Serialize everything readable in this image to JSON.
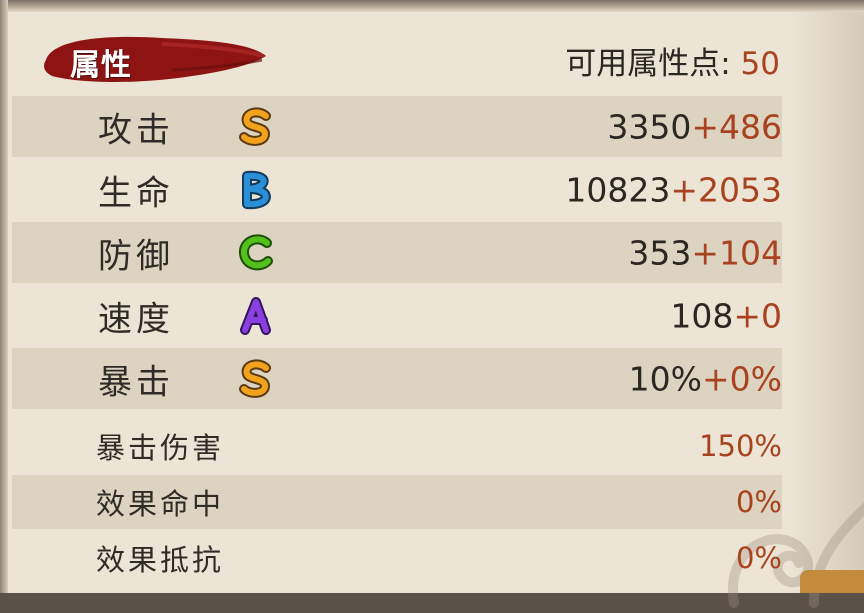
{
  "header": {
    "title": "属性",
    "points_label": "可用属性点:",
    "points_value": "50"
  },
  "main_stats": [
    {
      "label": "攻击",
      "grade": "S",
      "grade_color": "#f2a21c",
      "base": "3350",
      "bonus": "+486"
    },
    {
      "label": "生命",
      "grade": "B",
      "grade_color": "#2a8fd6",
      "base": "10823",
      "bonus": "+2053"
    },
    {
      "label": "防御",
      "grade": "C",
      "grade_color": "#52c21a",
      "base": "353",
      "bonus": "+104"
    },
    {
      "label": "速度",
      "grade": "A",
      "grade_color": "#8a3fe0",
      "base": "108",
      "bonus": "+0"
    },
    {
      "label": "暴击",
      "grade": "S",
      "grade_color": "#f2a21c",
      "base": "10%",
      "bonus": "+0%"
    }
  ],
  "sub_stats": [
    {
      "label": "暴击伤害",
      "value": "150%"
    },
    {
      "label": "效果命中",
      "value": "0%"
    },
    {
      "label": "效果抵抗",
      "value": "0%"
    }
  ],
  "colors": {
    "panel_bg": "#ece4d4",
    "row_shade": "#dcd3c1",
    "bonus_text": "#a8421f",
    "header_brush": "#8e1414"
  }
}
